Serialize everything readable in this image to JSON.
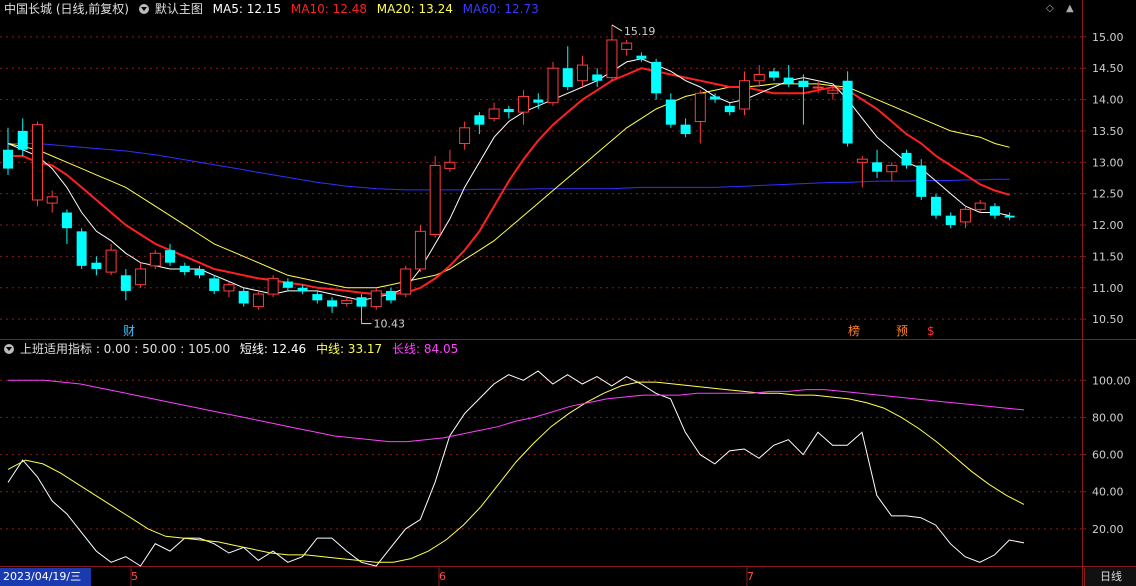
{
  "title_bar": {
    "stock_name": "中国长城 (日线,前复权)",
    "template_label": "默认主图",
    "ma5_label": "MA5: 12.15",
    "ma10_label": "MA10: 12.48",
    "ma20_label": "MA20: 13.24",
    "ma60_label": "MA60: 12.73"
  },
  "indicator_bar": {
    "name": "上班适用指标 : 0.00 : 50.00 : 105.00",
    "short_label": "短线: 12.46",
    "mid_label": "中线: 33.17",
    "long_label": "长线: 84.05"
  },
  "colors": {
    "up": "#ff3c3c",
    "down": "#00ffff",
    "ma5": "#ffffff",
    "ma10": "#ff2020",
    "ma20": "#ffff50",
    "ma60": "#3030ff",
    "long": "#ff40ff",
    "grid": "#8b1a1a"
  },
  "markers": {
    "high_label": "15.19",
    "low_label": "10.43",
    "cai": "财",
    "bang": "榜",
    "yu": "预",
    "s": "$"
  },
  "footer": {
    "date": "2023/04/19/三",
    "m5": "5",
    "m6": "6",
    "m7": "7",
    "period_button": "日线"
  },
  "chart_data": [
    {
      "type": "candlestick",
      "ylim": [
        10.2,
        15.3
      ],
      "yticks": [
        10.5,
        11.0,
        11.5,
        12.0,
        12.5,
        13.0,
        13.5,
        14.0,
        14.5,
        15.0
      ],
      "ytick_labels": [
        "10.50",
        "11.00",
        "11.50",
        "12.00",
        "12.50",
        "13.00",
        "13.50",
        "14.00",
        "14.50",
        "15.00"
      ],
      "candles": [
        [
          13.2,
          12.9,
          13.55,
          12.8
        ],
        [
          13.5,
          13.2,
          13.7,
          13.1
        ],
        [
          12.4,
          13.6,
          13.65,
          12.3
        ],
        [
          12.35,
          12.45,
          12.55,
          12.2
        ],
        [
          12.2,
          11.95,
          12.25,
          11.7
        ],
        [
          11.9,
          11.35,
          11.95,
          11.3
        ],
        [
          11.4,
          11.3,
          11.5,
          11.2
        ],
        [
          11.25,
          11.6,
          11.7,
          11.2
        ],
        [
          11.2,
          10.95,
          11.3,
          10.8
        ],
        [
          11.05,
          11.3,
          11.4,
          11.0
        ],
        [
          11.35,
          11.55,
          11.6,
          11.3
        ],
        [
          11.6,
          11.4,
          11.7,
          11.35
        ],
        [
          11.35,
          11.25,
          11.4,
          11.2
        ],
        [
          11.3,
          11.2,
          11.35,
          11.15
        ],
        [
          11.15,
          10.95,
          11.2,
          10.9
        ],
        [
          10.95,
          11.05,
          11.1,
          10.85
        ],
        [
          10.95,
          10.75,
          11.0,
          10.7
        ],
        [
          10.7,
          10.9,
          10.95,
          10.65
        ],
        [
          10.9,
          11.15,
          11.2,
          10.85
        ],
        [
          11.1,
          11.0,
          11.15,
          10.95
        ],
        [
          11.0,
          10.95,
          11.05,
          10.9
        ],
        [
          10.9,
          10.8,
          10.95,
          10.75
        ],
        [
          10.8,
          10.7,
          10.85,
          10.6
        ],
        [
          10.75,
          10.8,
          10.85,
          10.7
        ],
        [
          10.85,
          10.7,
          10.9,
          10.43
        ],
        [
          10.7,
          10.95,
          11.0,
          10.65
        ],
        [
          10.95,
          10.8,
          11.0,
          10.75
        ],
        [
          10.9,
          11.3,
          11.35,
          10.85
        ],
        [
          11.3,
          11.9,
          12.0,
          11.25
        ],
        [
          11.85,
          12.95,
          13.1,
          11.8
        ],
        [
          12.9,
          13.0,
          13.2,
          12.85
        ],
        [
          13.3,
          13.55,
          13.65,
          13.2
        ],
        [
          13.75,
          13.6,
          13.8,
          13.45
        ],
        [
          13.7,
          13.85,
          13.95,
          13.65
        ],
        [
          13.85,
          13.8,
          13.9,
          13.7
        ],
        [
          13.8,
          14.05,
          14.15,
          13.6
        ],
        [
          14.0,
          13.95,
          14.1,
          13.85
        ],
        [
          13.95,
          14.5,
          14.6,
          13.9
        ],
        [
          14.5,
          14.2,
          14.85,
          14.15
        ],
        [
          14.3,
          14.55,
          14.7,
          14.2
        ],
        [
          14.4,
          14.3,
          14.5,
          14.2
        ],
        [
          14.35,
          14.95,
          15.19,
          14.3
        ],
        [
          14.8,
          14.9,
          14.95,
          14.7
        ],
        [
          14.7,
          14.65,
          14.75,
          14.6
        ],
        [
          14.6,
          14.1,
          14.65,
          14.0
        ],
        [
          14.0,
          13.6,
          14.1,
          13.55
        ],
        [
          13.6,
          13.45,
          13.7,
          13.4
        ],
        [
          13.65,
          14.1,
          14.15,
          13.3
        ],
        [
          14.05,
          14.0,
          14.1,
          13.95
        ],
        [
          13.9,
          13.8,
          13.95,
          13.75
        ],
        [
          13.85,
          14.3,
          14.45,
          13.75
        ],
        [
          14.3,
          14.4,
          14.55,
          14.2
        ],
        [
          14.45,
          14.35,
          14.5,
          14.3
        ],
        [
          14.35,
          14.25,
          14.55,
          14.2
        ],
        [
          14.3,
          14.2,
          14.4,
          13.6
        ],
        [
          14.2,
          14.2,
          14.3,
          14.1
        ],
        [
          14.1,
          14.15,
          14.2,
          14.0
        ],
        [
          14.3,
          13.3,
          14.45,
          13.25
        ],
        [
          13.0,
          13.05,
          13.1,
          12.6
        ],
        [
          13.0,
          12.85,
          13.2,
          12.75
        ],
        [
          12.85,
          12.95,
          13.0,
          12.7
        ],
        [
          13.15,
          12.95,
          13.2,
          12.9
        ],
        [
          12.95,
          12.45,
          13.05,
          12.4
        ],
        [
          12.45,
          12.15,
          12.5,
          12.1
        ],
        [
          12.15,
          12.0,
          12.2,
          11.95
        ],
        [
          12.05,
          12.25,
          12.3,
          11.95
        ],
        [
          12.25,
          12.35,
          12.4,
          12.2
        ],
        [
          12.3,
          12.15,
          12.35,
          12.1
        ],
        [
          12.15,
          12.12,
          12.2,
          12.08
        ]
      ],
      "ma5": [
        13.3,
        13.2,
        13.1,
        12.9,
        12.6,
        12.2,
        11.9,
        11.75,
        11.55,
        11.4,
        11.35,
        11.3,
        11.3,
        11.3,
        11.2,
        11.1,
        11.0,
        10.95,
        10.9,
        10.95,
        10.95,
        10.95,
        10.9,
        10.85,
        10.8,
        10.85,
        10.9,
        11.0,
        11.3,
        11.7,
        12.1,
        12.6,
        13.0,
        13.4,
        13.65,
        13.8,
        13.9,
        14.0,
        14.1,
        14.2,
        14.3,
        14.45,
        14.6,
        14.65,
        14.55,
        14.45,
        14.3,
        14.2,
        14.05,
        13.95,
        14.0,
        14.1,
        14.2,
        14.3,
        14.35,
        14.3,
        14.25,
        14.0,
        13.7,
        13.4,
        13.2,
        13.0,
        12.9,
        12.7,
        12.5,
        12.3,
        12.2,
        12.2,
        12.15
      ],
      "ma10": [
        13.1,
        13.1,
        13.0,
        12.95,
        12.8,
        12.6,
        12.4,
        12.2,
        12.0,
        11.85,
        11.7,
        11.6,
        11.5,
        11.4,
        11.3,
        11.25,
        11.2,
        11.15,
        11.12,
        11.08,
        11.05,
        11.0,
        10.98,
        10.95,
        10.92,
        10.9,
        10.9,
        10.92,
        11.0,
        11.15,
        11.35,
        11.6,
        11.9,
        12.3,
        12.7,
        13.05,
        13.35,
        13.6,
        13.8,
        14.0,
        14.15,
        14.3,
        14.4,
        14.5,
        14.45,
        14.4,
        14.35,
        14.3,
        14.25,
        14.2,
        14.2,
        14.15,
        14.1,
        14.1,
        14.1,
        14.15,
        14.2,
        14.15,
        14.0,
        13.85,
        13.65,
        13.45,
        13.3,
        13.1,
        12.95,
        12.8,
        12.65,
        12.55,
        12.48
      ],
      "ma20": [
        13.3,
        13.25,
        13.2,
        13.1,
        13.0,
        12.9,
        12.8,
        12.7,
        12.6,
        12.45,
        12.3,
        12.15,
        12.0,
        11.85,
        11.7,
        11.6,
        11.5,
        11.4,
        11.3,
        11.2,
        11.15,
        11.1,
        11.05,
        11.0,
        11.0,
        11.0,
        11.05,
        11.1,
        11.15,
        11.2,
        11.3,
        11.45,
        11.6,
        11.75,
        11.95,
        12.15,
        12.35,
        12.55,
        12.75,
        12.95,
        13.15,
        13.35,
        13.55,
        13.7,
        13.85,
        13.95,
        14.05,
        14.1,
        14.15,
        14.2,
        14.2,
        14.22,
        14.25,
        14.25,
        14.25,
        14.25,
        14.22,
        14.2,
        14.1,
        14.0,
        13.9,
        13.8,
        13.7,
        13.6,
        13.5,
        13.45,
        13.4,
        13.3,
        13.24
      ],
      "ma60": [
        13.3,
        13.3,
        13.3,
        13.28,
        13.26,
        13.24,
        13.22,
        13.2,
        13.18,
        13.15,
        13.12,
        13.08,
        13.04,
        13.0,
        12.96,
        12.92,
        12.88,
        12.84,
        12.8,
        12.76,
        12.72,
        12.68,
        12.65,
        12.62,
        12.6,
        12.58,
        12.57,
        12.56,
        12.56,
        12.56,
        12.56,
        12.56,
        12.57,
        12.57,
        12.57,
        12.57,
        12.58,
        12.58,
        12.58,
        12.58,
        12.58,
        12.58,
        12.59,
        12.6,
        12.6,
        12.6,
        12.6,
        12.6,
        12.6,
        12.61,
        12.62,
        12.63,
        12.64,
        12.65,
        12.66,
        12.67,
        12.68,
        12.68,
        12.69,
        12.7,
        12.7,
        12.7,
        12.71,
        12.71,
        12.71,
        12.72,
        12.72,
        12.73,
        12.73
      ]
    },
    {
      "type": "line",
      "ylim": [
        0,
        112
      ],
      "yticks": [
        20,
        40,
        60,
        80,
        100
      ],
      "ytick_labels": [
        "20.00",
        "40.00",
        "60.00",
        "80.00",
        "100.00"
      ],
      "series": [
        {
          "name": "短线",
          "values": [
            45,
            57,
            48,
            35,
            28,
            18,
            8,
            2,
            5,
            0,
            12,
            8,
            15,
            15,
            12,
            7,
            10,
            3,
            8,
            2,
            5,
            15,
            15,
            8,
            2,
            0,
            10,
            20,
            25,
            45,
            70,
            82,
            90,
            98,
            103,
            100,
            105,
            98,
            103,
            98,
            102,
            97,
            102,
            98,
            93,
            90,
            72,
            60,
            55,
            62,
            63,
            58,
            65,
            68,
            60,
            72,
            65,
            65,
            72,
            38,
            27,
            27,
            26,
            22,
            12,
            5,
            2,
            6,
            14,
            12.46
          ]
        },
        {
          "name": "中线",
          "values": [
            52,
            57,
            55,
            50,
            44,
            38,
            32,
            26,
            20,
            16,
            15,
            14,
            13,
            11,
            9,
            7,
            6,
            6,
            5,
            4,
            3,
            2,
            2,
            4,
            8,
            14,
            22,
            32,
            44,
            56,
            66,
            75,
            82,
            88,
            93,
            97,
            99,
            99,
            98,
            97,
            96,
            95,
            94,
            93,
            93,
            92,
            92,
            91,
            90,
            88,
            85,
            80,
            74,
            67,
            59,
            51,
            44,
            38,
            33.17
          ]
        },
        {
          "name": "长线",
          "values": [
            100,
            100,
            100,
            99,
            98,
            96,
            94,
            92,
            90,
            88,
            86,
            84,
            82,
            80,
            78,
            76,
            74,
            72,
            70,
            69,
            68,
            67,
            67,
            68,
            69,
            71,
            73,
            75,
            78,
            80,
            83,
            86,
            88,
            90,
            91,
            92,
            92,
            92,
            93,
            93,
            93,
            93,
            94,
            94,
            95,
            95,
            94,
            93,
            92,
            91,
            90,
            89,
            88,
            87,
            86,
            85,
            84.05
          ]
        }
      ]
    }
  ]
}
